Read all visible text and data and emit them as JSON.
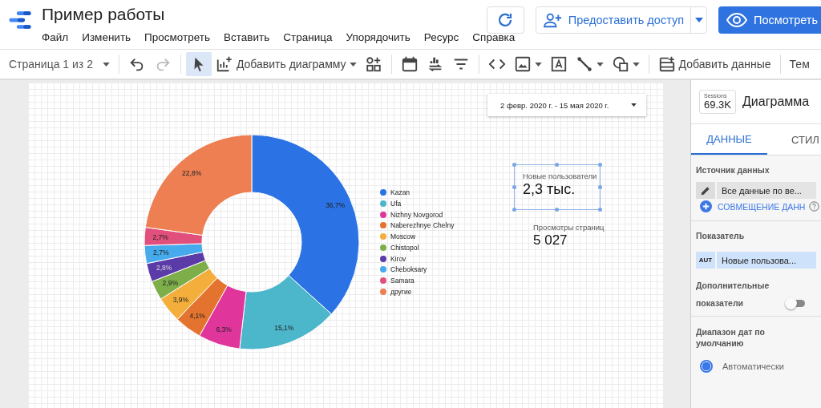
{
  "app": {
    "title": "Пример работы",
    "menu": [
      "Файл",
      "Изменить",
      "Просмотреть",
      "Вставить",
      "Страница",
      "Упорядочить",
      "Ресурс",
      "Справка"
    ]
  },
  "header_buttons": {
    "share": {
      "label": "Предоставить доступ"
    },
    "view": {
      "label": "Посмотреть"
    }
  },
  "toolbar": [
    {
      "kind": "page-select",
      "label": "Страница 1 из 2"
    },
    {
      "kind": "separator"
    },
    {
      "kind": "undo",
      "disabled": false
    },
    {
      "kind": "redo",
      "disabled": true
    },
    {
      "kind": "separator"
    },
    {
      "kind": "pointer",
      "selected": true
    },
    {
      "kind": "add-chart",
      "label": "Добавить диаграмму",
      "caret": true
    },
    {
      "kind": "add-control"
    },
    {
      "kind": "separator"
    },
    {
      "kind": "calendar"
    },
    {
      "kind": "sort"
    },
    {
      "kind": "filter"
    },
    {
      "kind": "separator"
    },
    {
      "kind": "code"
    },
    {
      "kind": "image",
      "caret": true
    },
    {
      "kind": "textbox"
    },
    {
      "kind": "line",
      "caret": true
    },
    {
      "kind": "shape",
      "caret": true
    },
    {
      "kind": "separator"
    },
    {
      "kind": "add-data",
      "label": "Добавить данные"
    },
    {
      "kind": "separator"
    },
    {
      "kind": "theme",
      "label": "Тем"
    }
  ],
  "canvas": {
    "date_range": {
      "value": "2 февр. 2020 г. - 15 мая 2020 г."
    },
    "chart_data": {
      "type": "donut",
      "legend": "right",
      "categories": [
        "Kazan",
        "Ufa",
        "Nizhny Novgorod",
        "Naberezhnye Chelny",
        "Moscow",
        "Chistopol",
        "Kirov",
        "Cheboksary",
        "Samara",
        "другие"
      ],
      "values": [
        36.7,
        15.1,
        6.3,
        4.1,
        3.9,
        2.9,
        2.8,
        2.7,
        2.7,
        22.8
      ],
      "colors": [
        "#2b72e4",
        "#4cb6ca",
        "#e0369c",
        "#e4732f",
        "#f3ae3b",
        "#7dae49",
        "#5b3ba8",
        "#46aaec",
        "#e1507d",
        "#ed7f53"
      ],
      "value_labels": [
        "36,7%",
        "15,1%",
        "6,3%",
        "4,1%",
        "3,9%",
        "2,9%",
        "2,8%",
        "2,7%",
        "2,7%",
        "22,8%"
      ]
    },
    "scorecards": [
      {
        "label": "Новые пользователи",
        "value": "2,3 тыс.",
        "selected": true
      },
      {
        "label": "Просмотры страниц",
        "value": "5 027",
        "selected": false
      }
    ]
  },
  "panel": {
    "thumb": {
      "label": "Sessions",
      "value": "69.3K"
    },
    "title": "Диаграмма",
    "tabs": [
      {
        "label": "ДАННЫЕ",
        "selected": true
      },
      {
        "label": "СТИЛ",
        "selected": false
      }
    ],
    "data_source": {
      "heading": "Источник данных",
      "value": "Все данные по ве...",
      "blend_link": "СОВМЕЩЕНИЕ ДАНН"
    },
    "metric": {
      "heading": "Показатель",
      "type": "AUT",
      "value": "Новые пользова..."
    },
    "optional_metrics": {
      "heading_1": "Дополнительные",
      "heading_2": "показатели",
      "on": false
    },
    "date_range": {
      "heading": "Диапазон дат по умолчанию",
      "options": [
        {
          "label": "Автоматически",
          "selected": true
        }
      ]
    }
  }
}
